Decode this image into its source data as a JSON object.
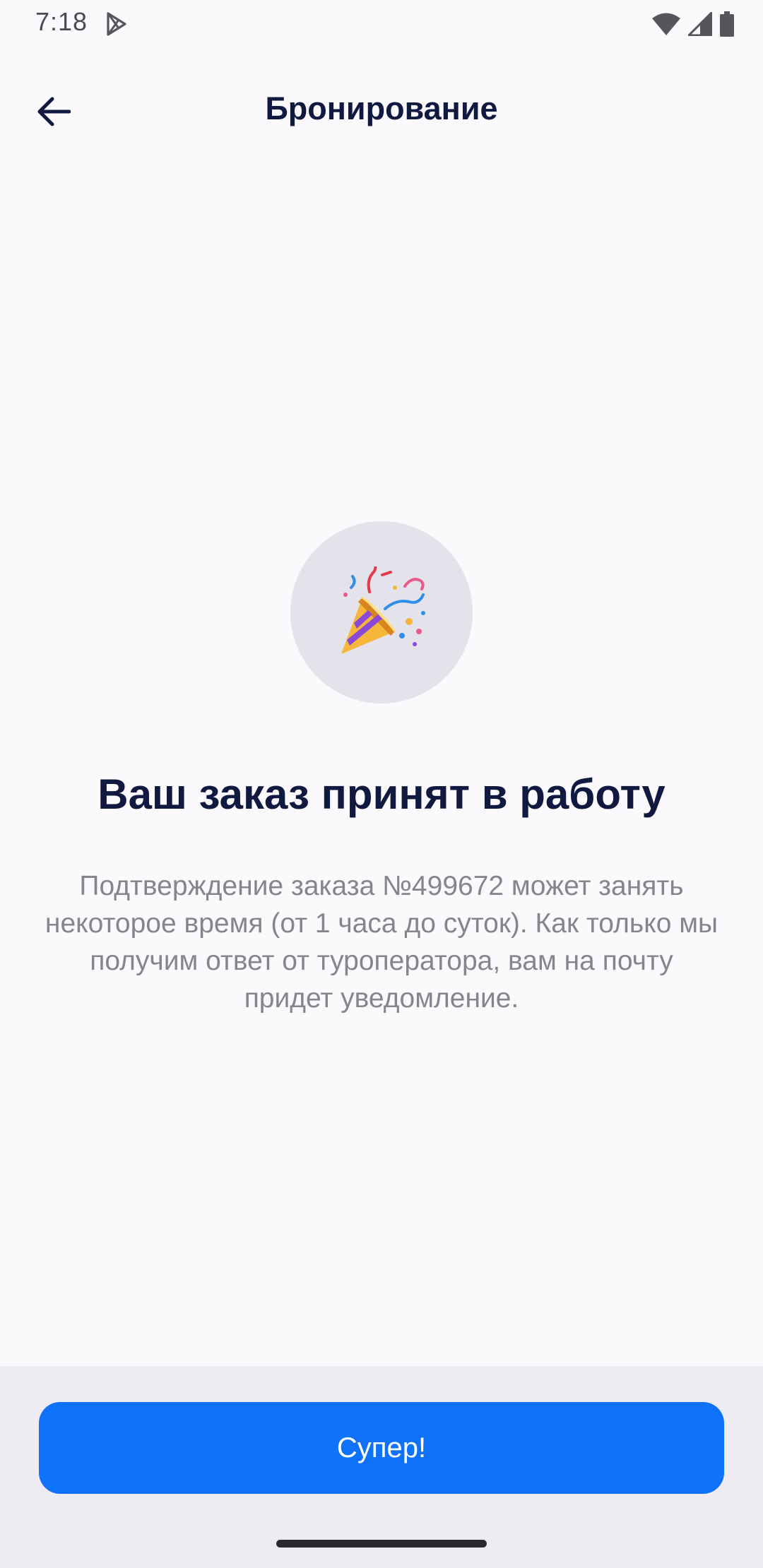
{
  "status_bar": {
    "time": "7:18",
    "play_icon": "play-store-icon",
    "wifi_icon": "wifi-icon",
    "signal_icon": "signal-icon",
    "battery_icon": "battery-icon"
  },
  "top_bar": {
    "back_icon": "arrow-left-icon",
    "title": "Бронирование"
  },
  "confirmation": {
    "icon": "party-popper-icon",
    "heading": "Ваш заказ принят в работу",
    "description": "Подтверждение заказа №499672 может занять некоторое время (от 1 часа до суток). Как только мы получим ответ от туроператора, вам на почту придет уведомление."
  },
  "footer": {
    "button_label": "Супер!"
  },
  "colors": {
    "background": "#fcf9fc",
    "title_text": "#10193f",
    "body_text": "#85858c",
    "accent": "#0e73fa",
    "panel": "#eeebf3",
    "circle": "#e4e2ea"
  }
}
